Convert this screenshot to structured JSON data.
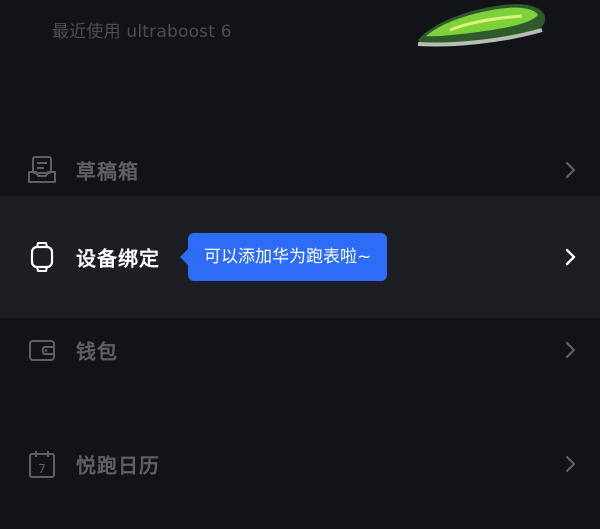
{
  "recent_used": "最近使用 ultraboost 6",
  "menu": {
    "drafts": {
      "label": "草稿箱",
      "icon": "drafts-icon"
    },
    "device": {
      "label": "设备绑定",
      "icon": "watch-icon",
      "tooltip": "可以添加华为跑表啦~"
    },
    "wallet": {
      "label": "钱包",
      "icon": "wallet-icon"
    },
    "calendar": {
      "label": "悦跑日历",
      "icon": "calendar-icon",
      "icon_text": "7"
    }
  },
  "colors": {
    "background": "#121317",
    "active_row": "#1d1e23",
    "tooltip": "#2d6cf6",
    "shoe_accent": "#7fd13b"
  }
}
